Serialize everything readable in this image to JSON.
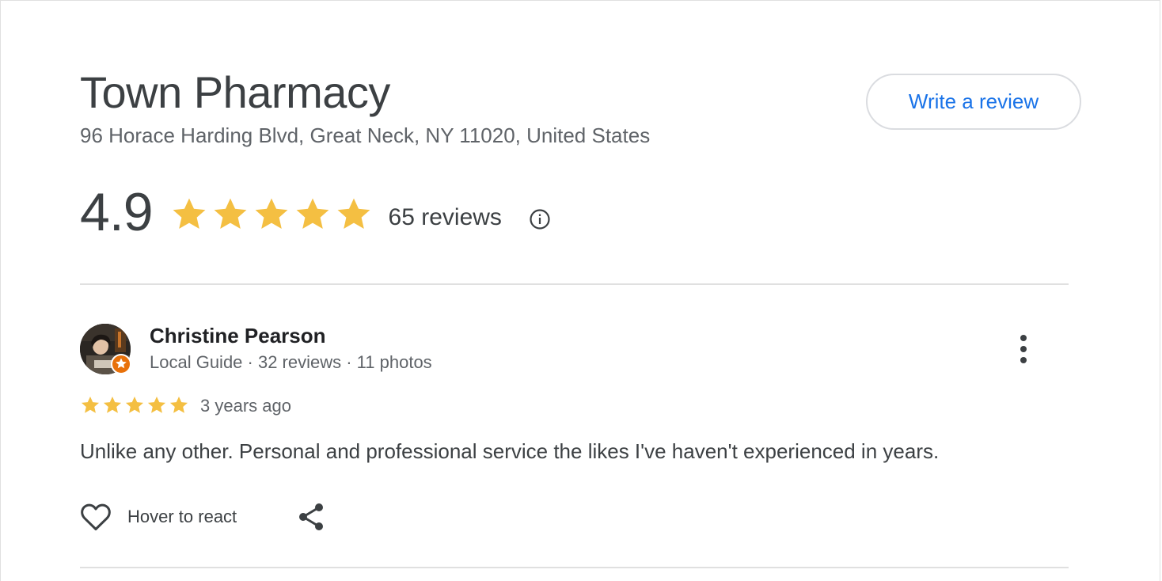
{
  "business": {
    "name": "Town Pharmacy",
    "address": "96 Horace Harding Blvd, Great Neck, NY 11020, United States",
    "write_review_label": "Write a review"
  },
  "rating": {
    "value": "4.9",
    "stars": 5,
    "count_label": "65 reviews"
  },
  "review": {
    "author": "Christine Pearson",
    "author_meta": "Local Guide · 32 reviews · 11 photos",
    "stars": 5,
    "date": "3 years ago",
    "text": "Unlike any other. Personal and professional service the likes I've haven't experienced in years.",
    "react_label": "Hover to react"
  },
  "colors": {
    "star": "#f4bf42",
    "accent": "#1a73e8",
    "guide_badge": "#e8710a"
  },
  "icons": [
    "star-icon",
    "info-icon",
    "local-guide-badge-icon",
    "more-vert-icon",
    "heart-icon",
    "share-icon"
  ]
}
